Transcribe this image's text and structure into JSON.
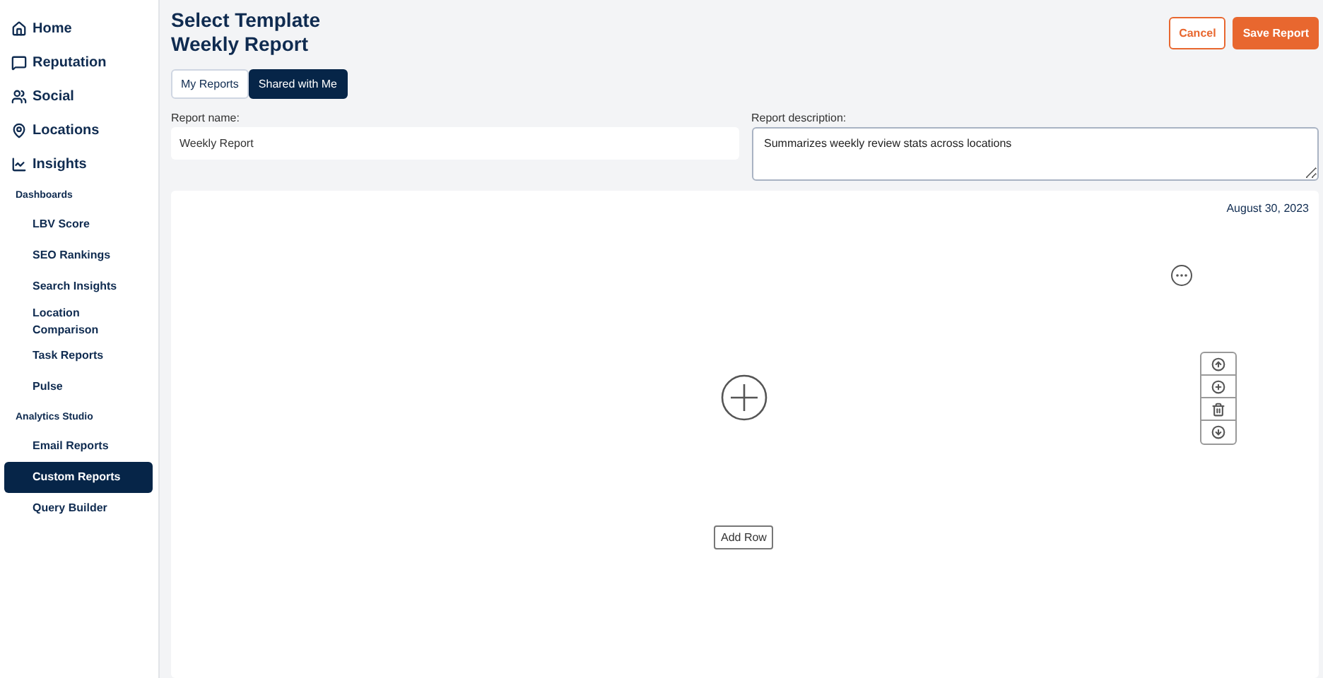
{
  "sidebar": {
    "items": [
      {
        "kind": "section",
        "label": "Home"
      },
      {
        "kind": "section",
        "label": "Reputation"
      },
      {
        "kind": "section",
        "label": "Social"
      },
      {
        "kind": "section",
        "label": "Locations"
      },
      {
        "kind": "section",
        "label": "Insights"
      },
      {
        "kind": "group",
        "label": "Dashboards"
      },
      {
        "kind": "link",
        "label": "LBV Score",
        "selected": false
      },
      {
        "kind": "link",
        "label": "SEO Rankings",
        "selected": false
      },
      {
        "kind": "link",
        "label": "Search Insights",
        "selected": false
      },
      {
        "kind": "link",
        "label": "Location Comparison",
        "selected": false
      },
      {
        "kind": "link",
        "label": "Task Reports",
        "selected": false
      },
      {
        "kind": "link",
        "label": "Pulse",
        "selected": false
      },
      {
        "kind": "group",
        "label": "Analytics Studio"
      },
      {
        "kind": "link",
        "label": "Email Reports",
        "selected": false
      },
      {
        "kind": "link",
        "label": "Custom Reports",
        "selected": true
      },
      {
        "kind": "link",
        "label": "Query Builder",
        "selected": false
      }
    ]
  },
  "header": {
    "title": "Select Template",
    "subtitle": "Weekly Report",
    "buttons": [
      {
        "kind": "outline",
        "label": "Cancel"
      },
      {
        "kind": "primary",
        "label": "Save Report"
      }
    ]
  },
  "tabs": [
    {
      "label": "My Reports",
      "selected": false
    },
    {
      "label": "Shared with Me",
      "selected": true
    }
  ],
  "form": {
    "name_label": "Report name:",
    "name_value": "Weekly Report",
    "description_label": "Report description:",
    "description_value": "Summarizes weekly review stats across locations"
  },
  "canvas": {
    "date": "August 30, 2023",
    "add_row": "Add Row"
  }
}
